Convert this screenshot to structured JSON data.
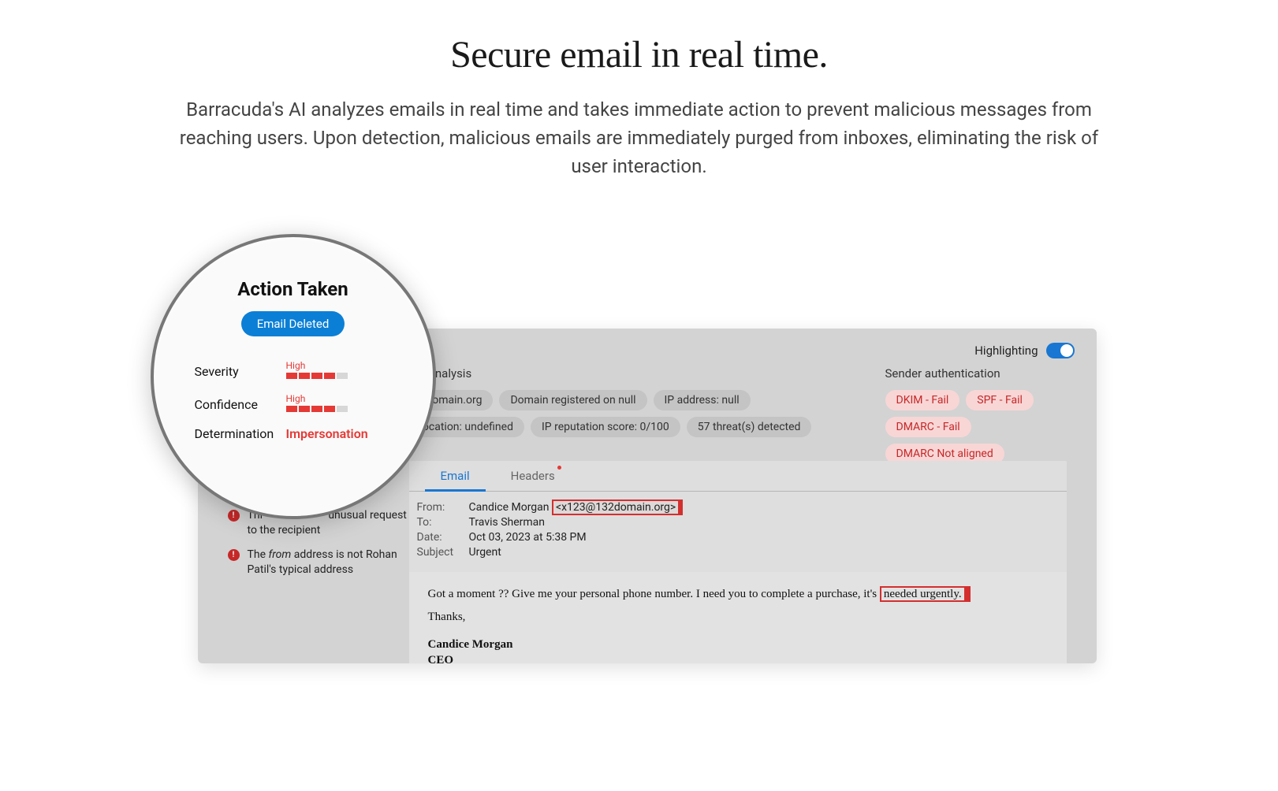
{
  "hero": {
    "title": "Secure email in real time.",
    "subtitle": "Barracuda's AI analyzes emails in real time and takes immediate action to prevent malicious messages from reaching users. Upon detection, malicious emails are immediately purged from inboxes, eliminating the risk of user interaction."
  },
  "magnifier": {
    "title": "Action Taken",
    "badge": "Email Deleted",
    "rows": {
      "severity_label": "Severity",
      "severity_level": "High",
      "confidence_label": "Confidence",
      "confidence_level": "High",
      "determination_label": "Determination",
      "determination_value": "Impersonation"
    }
  },
  "panel": {
    "highlighting_label": "Highlighting",
    "col_left_title": "der analysis",
    "col_right_title": "Sender authentication",
    "analysis_pills": [
      "2domain.org",
      "Domain registered on null",
      "IP address: null",
      "location: undefined",
      "IP reputation score: 0/100",
      "57 threat(s) detected"
    ],
    "auth_pills": [
      "DKIM - Fail",
      "SPF - Fail",
      "DMARC - Fail",
      "DMARC Not aligned"
    ]
  },
  "tabs": {
    "email": "Email",
    "headers": "Headers"
  },
  "email": {
    "from_label": "From:",
    "from_name": "Candice Morgan",
    "from_addr": "<x123@132domain.org>",
    "to_label": "To:",
    "to_value": "Travis Sherman",
    "date_label": "Date:",
    "date_value": "Oct 03, 2023 at 5:38 PM",
    "subject_label": "Subject",
    "subject_value": "Urgent",
    "body_prefix": "Got a moment ?? Give me your personal phone number. I need you to complete a purchase, it's ",
    "body_highlight": "needed urgently.",
    "thanks": "Thanks,",
    "sig_name": "Candice Morgan",
    "sig_title": "CEO"
  },
  "indicators": {
    "item1_prefix": "Thi",
    "item1_suffix": "unusual request to the recipient",
    "item2_a": "The ",
    "item2_italic": "from",
    "item2_b": " address is not Rohan Patil's typical address"
  }
}
